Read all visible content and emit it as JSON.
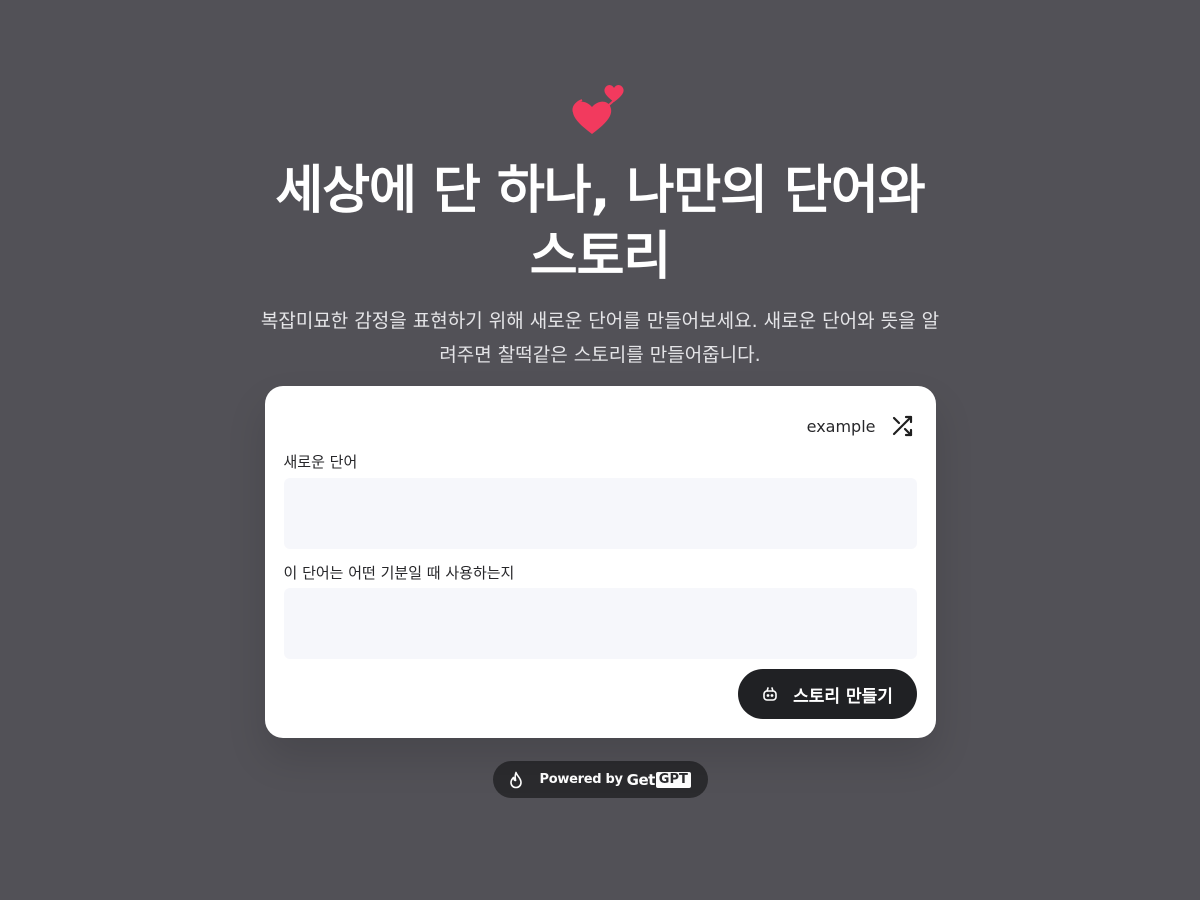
{
  "hero": {
    "title": "세상에 단 하나, 나만의 단어와 스토리",
    "subtitle": "복잡미묘한 감정을 표현하기 위해 새로운 단어를 만들어보세요. 새로운 단어와 뜻을 알려주면 찰떡같은 스토리를 만들어줍니다.",
    "icon": "hearts-icon",
    "accent_color": "#f23a5e"
  },
  "form": {
    "example_label": "example",
    "example_icon": "shuffle-icon",
    "word_label": "새로운 단어",
    "word_value": "",
    "usage_label": "이 단어는 어떤 기분일 때 사용하는지",
    "usage_value": "",
    "submit_label": "스토리 만들기",
    "submit_icon": "robot-icon"
  },
  "footer": {
    "powered_label": "Powered by",
    "brand_get": "Get",
    "brand_gpt": "GPT",
    "icon": "flame-icon"
  }
}
